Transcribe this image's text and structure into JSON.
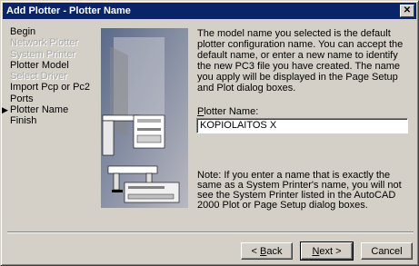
{
  "window": {
    "title": "Add Plotter - Plotter Name",
    "close_glyph": "✕"
  },
  "steps": [
    {
      "label": "Begin",
      "enabled": true,
      "current": false
    },
    {
      "label": "Network Plotter",
      "enabled": false,
      "current": false
    },
    {
      "label": "System Printer",
      "enabled": false,
      "current": false
    },
    {
      "label": "Plotter Model",
      "enabled": true,
      "current": false
    },
    {
      "label": "Select Driver",
      "enabled": false,
      "current": false
    },
    {
      "label": "Import Pcp or Pc2",
      "enabled": true,
      "current": false
    },
    {
      "label": "Ports",
      "enabled": true,
      "current": false
    },
    {
      "label": "Plotter Name",
      "enabled": true,
      "current": true
    },
    {
      "label": "Finish",
      "enabled": true,
      "current": false
    }
  ],
  "current_step_marker": "▶",
  "description": "The model name you selected is the default plotter configuration name. You can accept the default name, or enter a new name to identify the new PC3 file you have created. The name you apply will be displayed in the Page Setup and Plot dialog boxes.",
  "plotter_name": {
    "label_key": "P",
    "label_rest": "lotter Name:",
    "value": "KOPIOLAITOS X"
  },
  "note": "Note: If you enter a name that is exactly the same as a System Printer's name, you will not see the System Printer listed in the AutoCAD 2000 Plot or Page Setup dialog boxes.",
  "buttons": {
    "back": {
      "prefix": "< ",
      "key": "B",
      "rest": "ack"
    },
    "next": {
      "key": "N",
      "rest": "ext >"
    },
    "cancel": {
      "label": "Cancel"
    }
  },
  "colors": {
    "title_bar": "#0a246a",
    "face": "#d4d0c8"
  }
}
